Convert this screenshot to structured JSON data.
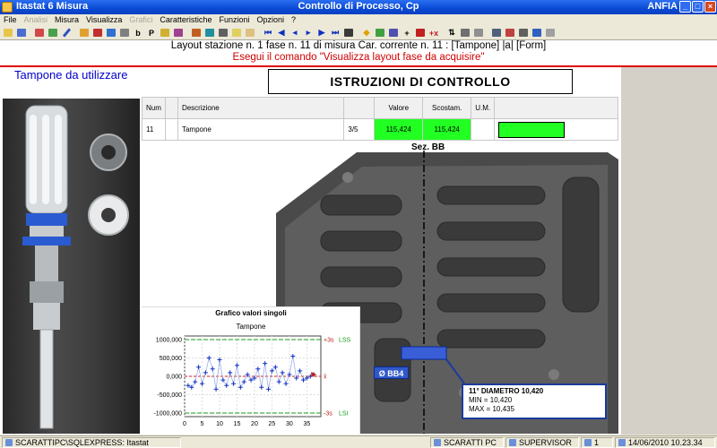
{
  "window": {
    "app_title": "Itastat 6 Misura",
    "doc_title": "Controllo di Processo, Cp",
    "right_label": "ANFIA",
    "minimize": "_",
    "maximize": "□",
    "close": "×"
  },
  "menu": [
    "File",
    "Analisi",
    "Misura",
    "Visualizza",
    "Grafici",
    "Caratteristiche",
    "Funzioni",
    "Opzioni",
    "?"
  ],
  "menu_disabled": [
    "Analisi",
    "Grafici"
  ],
  "toolbar": {
    "b_label": "b",
    "p_label": "P",
    "plus_label": "+",
    "plusx_label": "+x",
    "icons": [
      "open-icon",
      "save-icon",
      "print-icon",
      "chart-icon",
      "graph-icon",
      "ruler-icon",
      "pen-icon",
      "bars-icon",
      "grid-icon",
      "nav-first-icon",
      "nav-prev-icon",
      "nav-play-icon",
      "nav-next-icon",
      "nav-last-icon",
      "sort-icon",
      "lock-icon",
      "settings-icon",
      "help-icon",
      "exit-icon"
    ]
  },
  "header": {
    "line1": "Layout stazione n. 1 fase n. 11 di misura    Car. corrente n. 11 : [Tampone] |a| [Form]",
    "line2": "Esegui il comando \"Visualizza layout fase da acquisire\""
  },
  "panel": {
    "tampone_title": "Tampone da utilizzare",
    "istruzioni": "ISTRUZIONI DI CONTROLLO"
  },
  "table": {
    "headers": {
      "num": "Num",
      "descr": "Descrizione",
      "valore": "Valore",
      "scostam": "Scostam.",
      "um": "U.M."
    },
    "row": {
      "num": "11",
      "descr": "Tampone",
      "frac": "3/5",
      "valore": "115,424",
      "scostam": "115,424",
      "um": ""
    }
  },
  "drawing": {
    "section_label": "Sez. BB",
    "bb_label": "Ø BB4",
    "tip": {
      "title": "11° DIAMETRO 10,420",
      "min": "MIN = 10,420",
      "max": "MAX = 10,435"
    }
  },
  "chart_panel_title": "Grafico valori singoli",
  "chart_data": {
    "type": "line",
    "title": "Tampone",
    "xlabel": "",
    "ylabel": "",
    "ylim": [
      -1000000,
      1000000
    ],
    "xlim": [
      0,
      39
    ],
    "yticks": [
      "1000,000",
      "500,000",
      "0,000",
      "-500,000",
      "-1000,000"
    ],
    "ytick_values": [
      1000000,
      500000,
      0,
      -500000,
      -1000000
    ],
    "xticks": [
      "0",
      "5",
      "10",
      "15",
      "20",
      "25",
      "30",
      "35"
    ],
    "xtick_values": [
      0,
      5,
      10,
      15,
      20,
      25,
      30,
      35
    ],
    "limits": [
      {
        "label": "+3s",
        "name": "LSS",
        "value": 1000000,
        "color": "#1a9a1a"
      },
      {
        "label": "-3s",
        "name": "LSI",
        "value": -1000000,
        "color": "#1a9a1a"
      },
      {
        "label": "x̄",
        "value": 0,
        "color": "#d02020"
      }
    ],
    "series": [
      {
        "x": [
          1,
          2,
          3,
          4,
          5,
          6,
          7,
          8,
          9,
          10,
          11,
          12,
          13,
          14,
          15,
          16,
          17,
          18,
          19,
          20,
          21,
          22,
          23,
          24,
          25,
          26,
          27,
          28,
          29,
          30,
          31,
          32,
          33,
          34,
          35,
          36,
          37
        ],
        "values": [
          -250000,
          -300000,
          -150000,
          250000,
          -200000,
          100000,
          500000,
          200000,
          -350000,
          450000,
          -100000,
          -250000,
          100000,
          -200000,
          300000,
          -300000,
          -150000,
          50000,
          -100000,
          -50000,
          200000,
          -300000,
          350000,
          -350000,
          150000,
          250000,
          -150000,
          100000,
          -200000,
          50000,
          550000,
          -50000,
          150000,
          -100000,
          -50000,
          0,
          50000
        ]
      }
    ]
  },
  "statusbar": {
    "server": "SCARATTIPC\\SQLEXPRESS: Itastat",
    "pc": "SCARATTI PC",
    "role": "SUPERVISOR",
    "count": "1",
    "datetime": "14/06/2010 10.23.34"
  }
}
